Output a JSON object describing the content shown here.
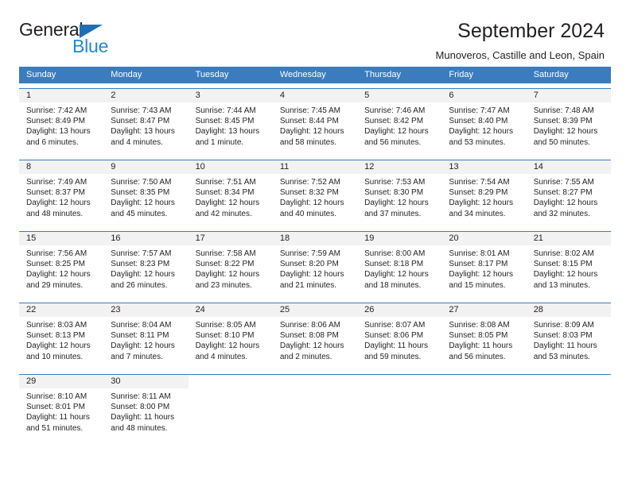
{
  "brand": {
    "name_part1": "General",
    "name_part2": "Blue",
    "triangle_color": "#1f6fb5",
    "blue_color": "#1f8ad6"
  },
  "header": {
    "title": "September 2024",
    "location": "Munoveros, Castille and Leon, Spain"
  },
  "theme": {
    "header_blue": "#3a7cbe",
    "day_band_gray": "#f2f2f2",
    "text": "#231f20"
  },
  "calendar": {
    "weekdays": [
      "Sunday",
      "Monday",
      "Tuesday",
      "Wednesday",
      "Thursday",
      "Friday",
      "Saturday"
    ],
    "weeks": [
      [
        {
          "day": "1",
          "sunrise": "Sunrise: 7:42 AM",
          "sunset": "Sunset: 8:49 PM",
          "daylight1": "Daylight: 13 hours",
          "daylight2": "and 6 minutes."
        },
        {
          "day": "2",
          "sunrise": "Sunrise: 7:43 AM",
          "sunset": "Sunset: 8:47 PM",
          "daylight1": "Daylight: 13 hours",
          "daylight2": "and 4 minutes."
        },
        {
          "day": "3",
          "sunrise": "Sunrise: 7:44 AM",
          "sunset": "Sunset: 8:45 PM",
          "daylight1": "Daylight: 13 hours",
          "daylight2": "and 1 minute."
        },
        {
          "day": "4",
          "sunrise": "Sunrise: 7:45 AM",
          "sunset": "Sunset: 8:44 PM",
          "daylight1": "Daylight: 12 hours",
          "daylight2": "and 58 minutes."
        },
        {
          "day": "5",
          "sunrise": "Sunrise: 7:46 AM",
          "sunset": "Sunset: 8:42 PM",
          "daylight1": "Daylight: 12 hours",
          "daylight2": "and 56 minutes."
        },
        {
          "day": "6",
          "sunrise": "Sunrise: 7:47 AM",
          "sunset": "Sunset: 8:40 PM",
          "daylight1": "Daylight: 12 hours",
          "daylight2": "and 53 minutes."
        },
        {
          "day": "7",
          "sunrise": "Sunrise: 7:48 AM",
          "sunset": "Sunset: 8:39 PM",
          "daylight1": "Daylight: 12 hours",
          "daylight2": "and 50 minutes."
        }
      ],
      [
        {
          "day": "8",
          "sunrise": "Sunrise: 7:49 AM",
          "sunset": "Sunset: 8:37 PM",
          "daylight1": "Daylight: 12 hours",
          "daylight2": "and 48 minutes."
        },
        {
          "day": "9",
          "sunrise": "Sunrise: 7:50 AM",
          "sunset": "Sunset: 8:35 PM",
          "daylight1": "Daylight: 12 hours",
          "daylight2": "and 45 minutes."
        },
        {
          "day": "10",
          "sunrise": "Sunrise: 7:51 AM",
          "sunset": "Sunset: 8:34 PM",
          "daylight1": "Daylight: 12 hours",
          "daylight2": "and 42 minutes."
        },
        {
          "day": "11",
          "sunrise": "Sunrise: 7:52 AM",
          "sunset": "Sunset: 8:32 PM",
          "daylight1": "Daylight: 12 hours",
          "daylight2": "and 40 minutes."
        },
        {
          "day": "12",
          "sunrise": "Sunrise: 7:53 AM",
          "sunset": "Sunset: 8:30 PM",
          "daylight1": "Daylight: 12 hours",
          "daylight2": "and 37 minutes."
        },
        {
          "day": "13",
          "sunrise": "Sunrise: 7:54 AM",
          "sunset": "Sunset: 8:29 PM",
          "daylight1": "Daylight: 12 hours",
          "daylight2": "and 34 minutes."
        },
        {
          "day": "14",
          "sunrise": "Sunrise: 7:55 AM",
          "sunset": "Sunset: 8:27 PM",
          "daylight1": "Daylight: 12 hours",
          "daylight2": "and 32 minutes."
        }
      ],
      [
        {
          "day": "15",
          "sunrise": "Sunrise: 7:56 AM",
          "sunset": "Sunset: 8:25 PM",
          "daylight1": "Daylight: 12 hours",
          "daylight2": "and 29 minutes."
        },
        {
          "day": "16",
          "sunrise": "Sunrise: 7:57 AM",
          "sunset": "Sunset: 8:23 PM",
          "daylight1": "Daylight: 12 hours",
          "daylight2": "and 26 minutes."
        },
        {
          "day": "17",
          "sunrise": "Sunrise: 7:58 AM",
          "sunset": "Sunset: 8:22 PM",
          "daylight1": "Daylight: 12 hours",
          "daylight2": "and 23 minutes."
        },
        {
          "day": "18",
          "sunrise": "Sunrise: 7:59 AM",
          "sunset": "Sunset: 8:20 PM",
          "daylight1": "Daylight: 12 hours",
          "daylight2": "and 21 minutes."
        },
        {
          "day": "19",
          "sunrise": "Sunrise: 8:00 AM",
          "sunset": "Sunset: 8:18 PM",
          "daylight1": "Daylight: 12 hours",
          "daylight2": "and 18 minutes."
        },
        {
          "day": "20",
          "sunrise": "Sunrise: 8:01 AM",
          "sunset": "Sunset: 8:17 PM",
          "daylight1": "Daylight: 12 hours",
          "daylight2": "and 15 minutes."
        },
        {
          "day": "21",
          "sunrise": "Sunrise: 8:02 AM",
          "sunset": "Sunset: 8:15 PM",
          "daylight1": "Daylight: 12 hours",
          "daylight2": "and 13 minutes."
        }
      ],
      [
        {
          "day": "22",
          "sunrise": "Sunrise: 8:03 AM",
          "sunset": "Sunset: 8:13 PM",
          "daylight1": "Daylight: 12 hours",
          "daylight2": "and 10 minutes."
        },
        {
          "day": "23",
          "sunrise": "Sunrise: 8:04 AM",
          "sunset": "Sunset: 8:11 PM",
          "daylight1": "Daylight: 12 hours",
          "daylight2": "and 7 minutes."
        },
        {
          "day": "24",
          "sunrise": "Sunrise: 8:05 AM",
          "sunset": "Sunset: 8:10 PM",
          "daylight1": "Daylight: 12 hours",
          "daylight2": "and 4 minutes."
        },
        {
          "day": "25",
          "sunrise": "Sunrise: 8:06 AM",
          "sunset": "Sunset: 8:08 PM",
          "daylight1": "Daylight: 12 hours",
          "daylight2": "and 2 minutes."
        },
        {
          "day": "26",
          "sunrise": "Sunrise: 8:07 AM",
          "sunset": "Sunset: 8:06 PM",
          "daylight1": "Daylight: 11 hours",
          "daylight2": "and 59 minutes."
        },
        {
          "day": "27",
          "sunrise": "Sunrise: 8:08 AM",
          "sunset": "Sunset: 8:05 PM",
          "daylight1": "Daylight: 11 hours",
          "daylight2": "and 56 minutes."
        },
        {
          "day": "28",
          "sunrise": "Sunrise: 8:09 AM",
          "sunset": "Sunset: 8:03 PM",
          "daylight1": "Daylight: 11 hours",
          "daylight2": "and 53 minutes."
        }
      ],
      [
        {
          "day": "29",
          "sunrise": "Sunrise: 8:10 AM",
          "sunset": "Sunset: 8:01 PM",
          "daylight1": "Daylight: 11 hours",
          "daylight2": "and 51 minutes."
        },
        {
          "day": "30",
          "sunrise": "Sunrise: 8:11 AM",
          "sunset": "Sunset: 8:00 PM",
          "daylight1": "Daylight: 11 hours",
          "daylight2": "and 48 minutes."
        },
        {
          "day": "",
          "sunrise": "",
          "sunset": "",
          "daylight1": "",
          "daylight2": ""
        },
        {
          "day": "",
          "sunrise": "",
          "sunset": "",
          "daylight1": "",
          "daylight2": ""
        },
        {
          "day": "",
          "sunrise": "",
          "sunset": "",
          "daylight1": "",
          "daylight2": ""
        },
        {
          "day": "",
          "sunrise": "",
          "sunset": "",
          "daylight1": "",
          "daylight2": ""
        },
        {
          "day": "",
          "sunrise": "",
          "sunset": "",
          "daylight1": "",
          "daylight2": ""
        }
      ]
    ]
  }
}
